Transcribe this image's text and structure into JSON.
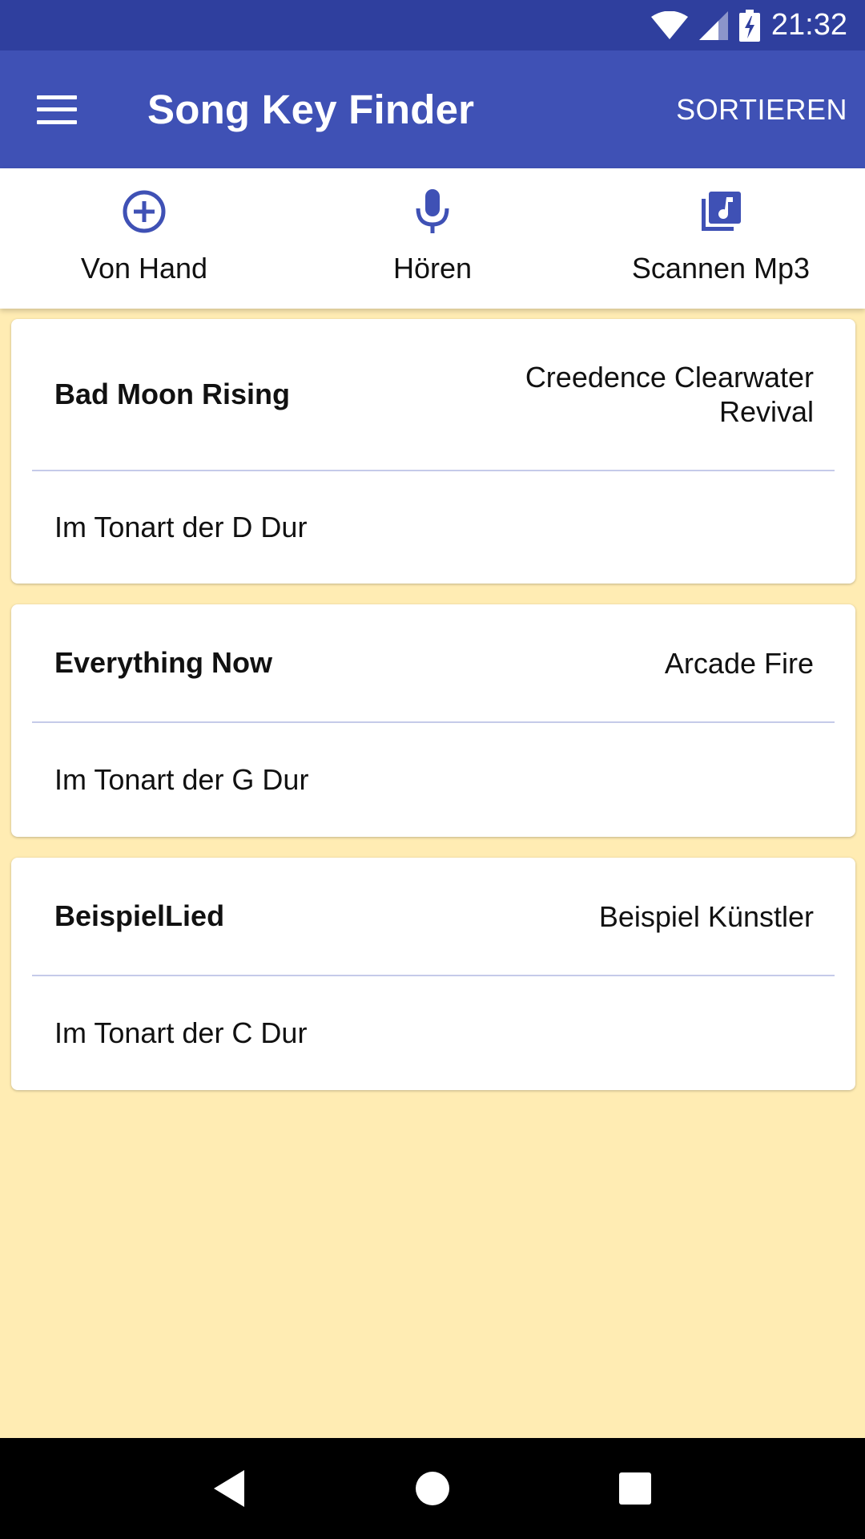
{
  "status_bar": {
    "time": "21:32",
    "icons": [
      "wifi-icon",
      "signal-icon",
      "battery-charging-icon"
    ]
  },
  "app_bar": {
    "title": "Song Key Finder",
    "menu_icon": "menu-icon",
    "sort_label": "SORTIEREN"
  },
  "actions": [
    {
      "label": "Von Hand",
      "icon": "add-circle-icon"
    },
    {
      "label": "Hören",
      "icon": "microphone-icon"
    },
    {
      "label": "Scannen Mp3",
      "icon": "music-library-icon"
    }
  ],
  "songs": [
    {
      "title": "Bad Moon Rising",
      "artist_line1": "Creedence Clearwater",
      "artist_line2": "Revival",
      "key": "Im Tonart der D Dur"
    },
    {
      "title": "Everything Now",
      "artist_line1": "Arcade Fire",
      "artist_line2": "",
      "key": "Im Tonart der G Dur"
    },
    {
      "title": "BeispielLied",
      "artist_line1": "Beispiel Künstler",
      "artist_line2": "",
      "key": "Im Tonart der C Dur"
    }
  ],
  "nav_bar": {
    "buttons": [
      "back-icon",
      "home-icon",
      "recents-icon"
    ]
  },
  "colors": {
    "primary": "#3F51B5",
    "primary_dark": "#2F3F9E",
    "background": "#FFECB3",
    "divider": "#C5CAE9"
  }
}
